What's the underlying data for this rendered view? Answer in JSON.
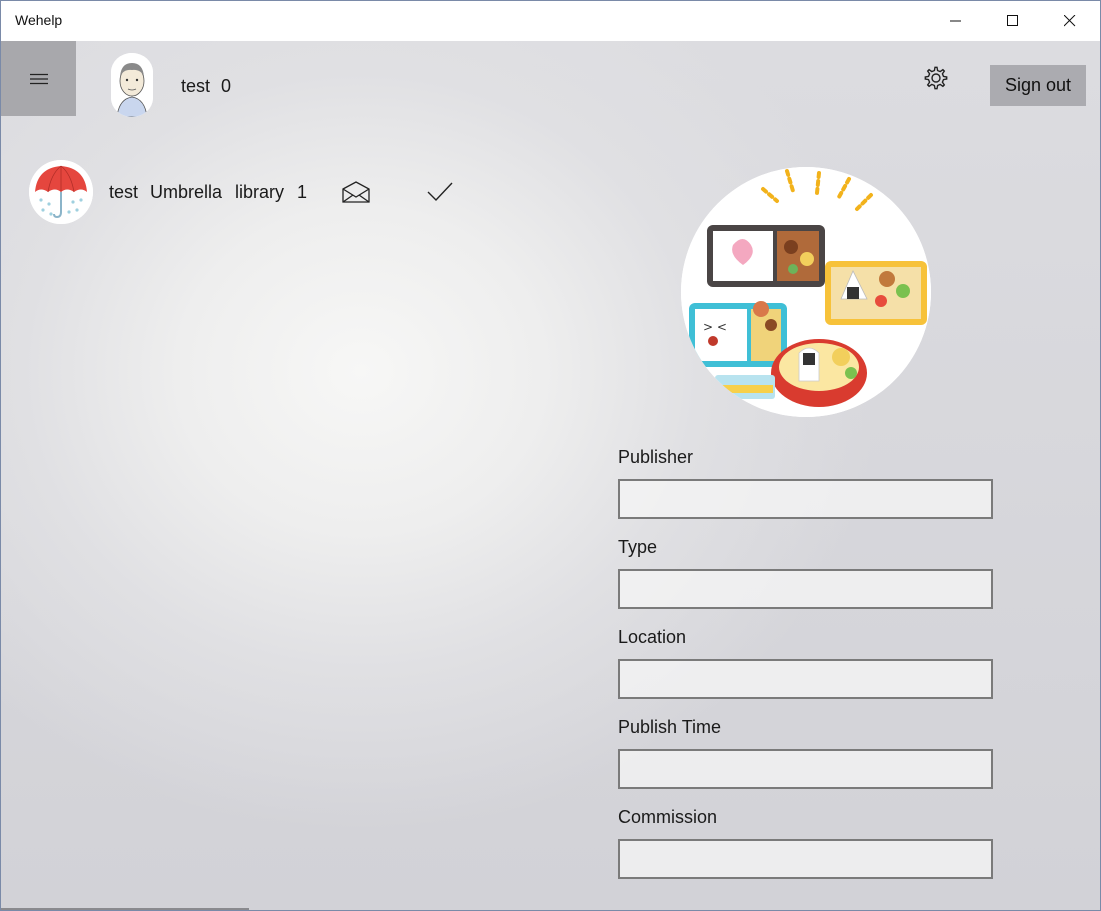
{
  "window": {
    "title": "Wehelp",
    "controls": [
      "minimize",
      "maximize",
      "close"
    ]
  },
  "header": {
    "menu_icon": "hamburger-icon",
    "user_name": "test",
    "user_count": "0",
    "settings_icon": "gear-icon",
    "signout_label": "Sign out"
  },
  "request_item": {
    "avatar_icon": "umbrella-icon",
    "user": "test",
    "item": "Umbrella",
    "place": "library",
    "count": "1",
    "mail_icon": "open-envelope-icon",
    "check_icon": "checkmark-icon"
  },
  "detail": {
    "image_icon": "bento-boxes-illustration",
    "fields": [
      {
        "label": "Publisher",
        "value": ""
      },
      {
        "label": "Type",
        "value": ""
      },
      {
        "label": "Location",
        "value": ""
      },
      {
        "label": "Publish Time",
        "value": ""
      },
      {
        "label": "Commission",
        "value": ""
      }
    ]
  }
}
